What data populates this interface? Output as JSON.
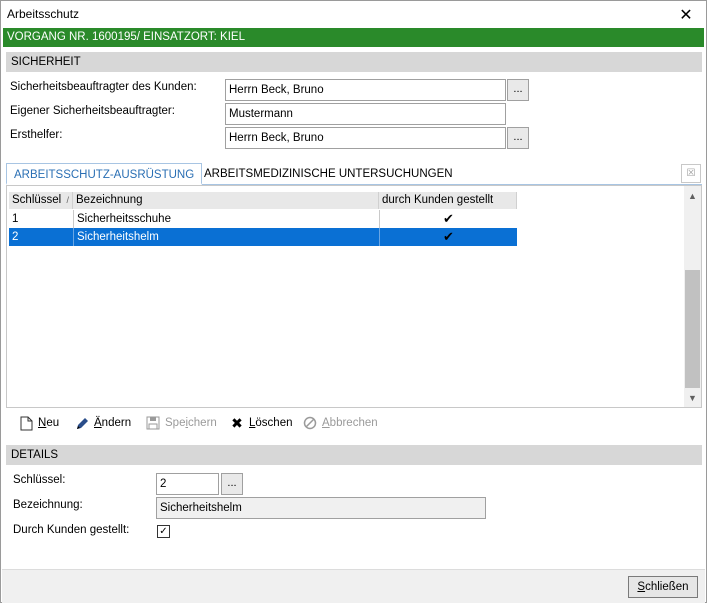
{
  "window": {
    "title": "Arbeitsschutz",
    "close_glyph": "✕"
  },
  "banner": {
    "text": "VORGANG NR. 1600195/ EINSATZORT: KIEL"
  },
  "sicherheit": {
    "heading": "SICHERHEIT",
    "fields": [
      {
        "label": "Sicherheitsbeauftragter des Kunden:",
        "value": "Herrn Beck, Bruno",
        "has_button": true
      },
      {
        "label": "Eigener Sicherheitsbeauftragter:",
        "value": "Mustermann",
        "has_button": false
      },
      {
        "label": "Ersthelfer:",
        "value": "Herrn Beck, Bruno",
        "has_button": true
      }
    ],
    "button_label": "..."
  },
  "tabs": [
    {
      "label": "ARBEITSSCHUTZ-AUSRÜSTUNG",
      "active": true
    },
    {
      "label": "ARBEITSMEDIZINISCHE UNTERSUCHUNGEN",
      "active": false
    }
  ],
  "grid": {
    "columns": [
      "Schlüssel",
      "Bezeichnung",
      "durch Kunden gestellt"
    ],
    "sort_indicator": "/",
    "rows": [
      {
        "key": "1",
        "name": "Sicherheitsschuhe",
        "by_customer": true,
        "selected": false
      },
      {
        "key": "2",
        "name": "Sicherheitshelm",
        "by_customer": true,
        "selected": true
      }
    ],
    "check_glyph": "✔"
  },
  "toolbar": {
    "new": {
      "pre": "",
      "u": "N",
      "post": "eu"
    },
    "edit": {
      "pre": "",
      "u": "Ä",
      "post": "ndern"
    },
    "save": {
      "pre": "Spe",
      "u": "i",
      "post": "chern"
    },
    "delete": {
      "pre": "",
      "u": "L",
      "post": "öschen"
    },
    "cancel": {
      "pre": "",
      "u": "A",
      "post": "bbrechen"
    }
  },
  "details": {
    "heading": "DETAILS",
    "key_label": "Schlüssel:",
    "key_value": "2",
    "name_label": "Bezeichnung:",
    "name_value": "Sicherheitshelm",
    "customer_label": "Durch Kunden gestellt:",
    "customer_checked": true,
    "check_glyph": "✓"
  },
  "footer": {
    "close": {
      "pre": "",
      "u": "S",
      "post": "chließen"
    }
  }
}
